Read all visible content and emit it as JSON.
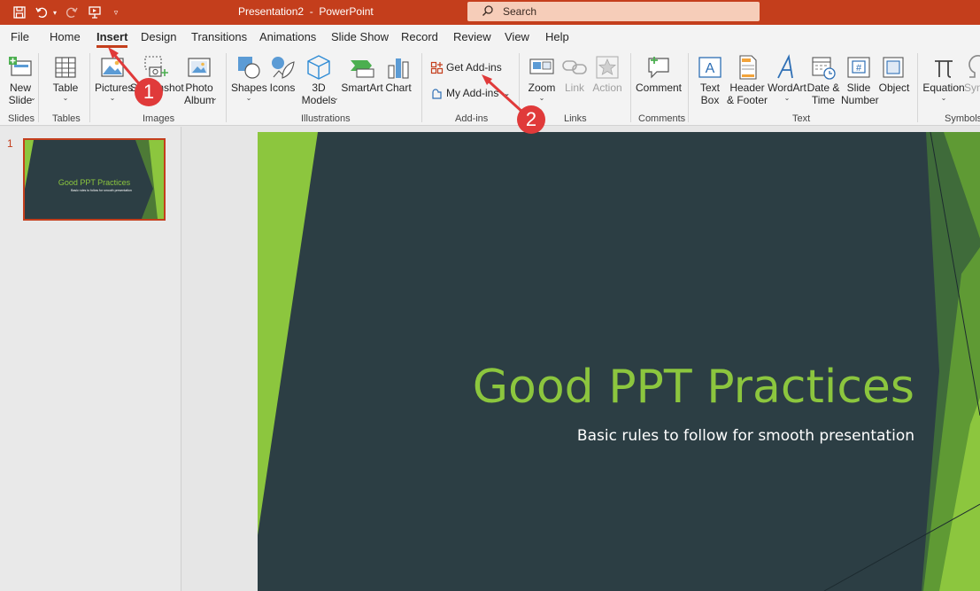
{
  "app": {
    "title": "Presentation2  -  PowerPoint",
    "search_placeholder": "Search"
  },
  "menu": {
    "tabs": [
      "File",
      "Home",
      "Insert",
      "Design",
      "Transitions",
      "Animations",
      "Slide Show",
      "Record",
      "Review",
      "View",
      "Help"
    ],
    "active": "Insert"
  },
  "ribbon": {
    "buttons": {
      "new_slide": "New\nSlide",
      "table": "Table",
      "pictures": "Pictures",
      "screenshot": "Screenshot",
      "photo_album": "Photo\nAlbum",
      "shapes": "Shapes",
      "icons": "Icons",
      "models_3d": "3D\nModels",
      "smartart": "SmartArt",
      "chart": "Chart",
      "get_addins": "Get Add-ins",
      "my_addins": "My Add-ins",
      "zoom": "Zoom",
      "link": "Link",
      "action": "Action",
      "comment": "Comment",
      "text_box": "Text\nBox",
      "header_footer": "Header\n& Footer",
      "wordart": "WordArt",
      "date_time": "Date &\nTime",
      "slide_number": "Slide\nNumber",
      "object": "Object",
      "equation": "Equation",
      "symbol": "Sym"
    },
    "groups": {
      "slides": "Slides",
      "tables": "Tables",
      "images": "Images",
      "illustrations": "Illustrations",
      "addins": "Add-ins",
      "links": "Links",
      "comments": "Comments",
      "text": "Text",
      "symbols": "Symbols"
    }
  },
  "slides_pane": {
    "number": "1",
    "thumb_title": "Good PPT Practices",
    "thumb_subtitle": "Basic rules to follow for smooth presentation"
  },
  "slide": {
    "title": "Good PPT Practices",
    "subtitle": "Basic rules to follow for smooth presentation"
  },
  "annotations": {
    "badge_1": "1",
    "badge_2": "2"
  },
  "colors": {
    "accent": "#c43e1c",
    "slide_bg": "#2c3e44",
    "slide_green": "#8cc63e",
    "badge": "#e03a3a"
  }
}
